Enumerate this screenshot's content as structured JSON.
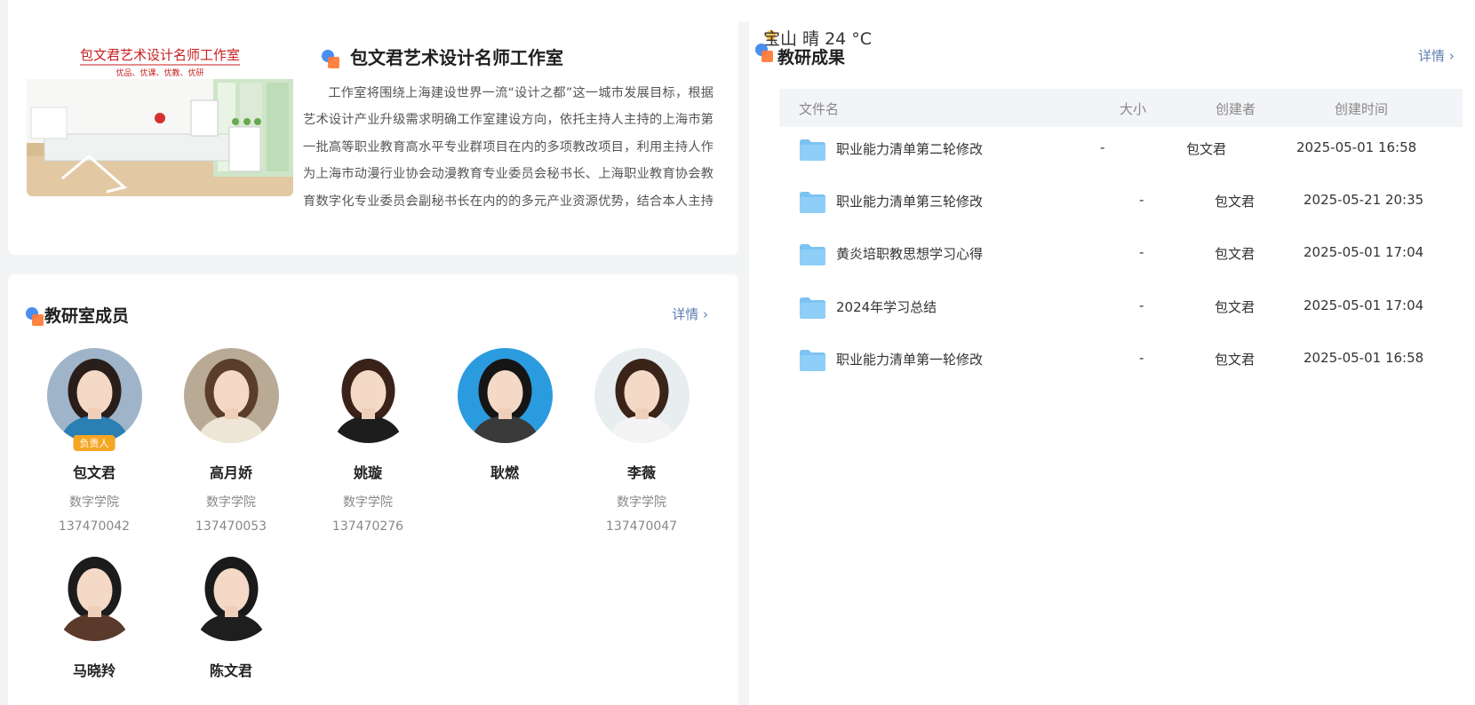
{
  "intro": {
    "title": "包文君艺术设计名师工作室",
    "image_title": "包文君艺术设计名师工作室",
    "image_subtitle": "优品、优课、优教、优研",
    "description": "工作室将围绕上海建设世界一流“设计之都”这一城市发展目标，根据艺术设计产业升级需求明确工作室建设方向，依托主持人主持的上海市第一批高等职业教育高水平专业群项目在内的多项教改项目，利用主持人作为上海市动漫行业协会动漫教育专业委员会秘书长、上海职业教育协会教育数字化专业委员会副秘书长在内的的多元产业资源优势，结合本人主持获得的教学成果奖、入围教育部的产…"
  },
  "members": {
    "title": "教研室成员",
    "detail_label": "详情 ›",
    "items": [
      {
        "name": "包文君",
        "dept": "数字学院",
        "id": "137470042",
        "badge": "负责人",
        "bg": "#9fb4c8",
        "hair": "#2a1e1a",
        "cloth": "#2a7fb3"
      },
      {
        "name": "高月娇",
        "dept": "数字学院",
        "id": "137470053",
        "badge": "",
        "bg": "#b8aa95",
        "hair": "#5a3d2b",
        "cloth": "#efe6d8"
      },
      {
        "name": "姚璇",
        "dept": "数字学院",
        "id": "137470276",
        "badge": "",
        "bg": "#ffffff",
        "hair": "#3a2219",
        "cloth": "#1d1d1d"
      },
      {
        "name": "耿燃",
        "dept": "",
        "id": "",
        "badge": "",
        "bg": "#2b9bdf",
        "hair": "#151515",
        "cloth": "#3a3a3a"
      },
      {
        "name": "李薇",
        "dept": "数字学院",
        "id": "137470047",
        "badge": "",
        "bg": "#e8eef0",
        "hair": "#3a2419",
        "cloth": "#f4f4f4"
      },
      {
        "name": "马晓羚",
        "dept": "",
        "id": "",
        "badge": "",
        "bg": "#ffffff",
        "hair": "#1c1c1c",
        "cloth": "#5a3a2a"
      },
      {
        "name": "陈文君",
        "dept": "",
        "id": "",
        "badge": "",
        "bg": "#ffffff",
        "hair": "#1a1a1a",
        "cloth": "#1e1e1e"
      }
    ]
  },
  "weather": {
    "text": "宝山  晴  24 °C"
  },
  "results": {
    "title": "教研成果",
    "detail_label": "详情 ›",
    "columns": [
      "文件名",
      "大小",
      "创建者",
      "创建时间"
    ],
    "rows": [
      {
        "name": "职业能力清单第二轮修改",
        "size": "-",
        "creator": "包文君",
        "time": "2025-05-01 16:58"
      },
      {
        "name": "职业能力清单第三轮修改",
        "size": "-",
        "creator": "包文君",
        "time": "2025-05-21 20:35"
      },
      {
        "name": "黄炎培职教思想学习心得",
        "size": "-",
        "creator": "包文君",
        "time": "2025-05-01 17:04"
      },
      {
        "name": "2024年学习总结",
        "size": "-",
        "creator": "包文君",
        "time": "2025-05-01 17:04"
      },
      {
        "name": "职业能力清单第一轮修改",
        "size": "-",
        "creator": "包文君",
        "time": "2025-05-01 16:58"
      }
    ]
  },
  "colors": {
    "accent_blue": "#4a8ef0",
    "accent_orange": "#ff7a34",
    "link": "#5e7fb0",
    "folder": "#7cc3f3",
    "badge": "#f6a623"
  }
}
